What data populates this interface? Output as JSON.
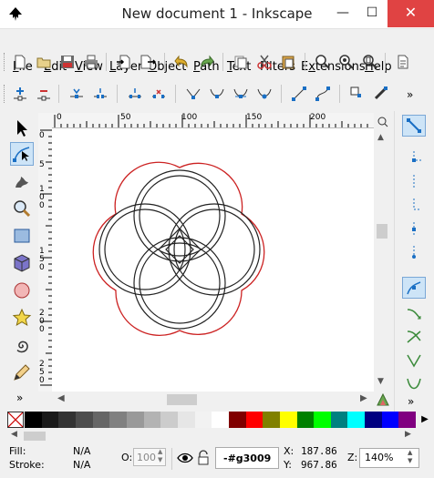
{
  "window": {
    "title": "New document 1 - Inkscape",
    "minimize": "—",
    "maximize": "☐",
    "close": "✕"
  },
  "menu": [
    {
      "label": "File",
      "u": "F",
      "rest": "ile"
    },
    {
      "label": "Edit",
      "u": "E",
      "rest": "dit"
    },
    {
      "label": "View",
      "u": "V",
      "rest": "iew"
    },
    {
      "label": "Layer",
      "u": "L",
      "rest": "ayer"
    },
    {
      "label": "Object",
      "u": "O",
      "rest": "bject"
    },
    {
      "label": "Path",
      "u": "P",
      "rest": "ath"
    },
    {
      "label": "Text",
      "u": "T",
      "rest": "ext"
    },
    {
      "label": "Filters",
      "u": "",
      "rest": "Filters"
    },
    {
      "label": "Extensions",
      "u": "x",
      "rest": "tensions"
    },
    {
      "label": "Help",
      "u": "H",
      "rest": "elp"
    }
  ],
  "rulers": {
    "top": [
      "0",
      "50",
      "100",
      "150",
      "200"
    ],
    "left": [
      "0",
      "5",
      "1 0 0",
      "1 5 0",
      "2 0 0",
      "2 5 0"
    ]
  },
  "expanders": {
    "overflow": "»"
  },
  "palette": [
    "#000000",
    "#1a1a1a",
    "#333333",
    "#4d4d4d",
    "#666666",
    "#808080",
    "#999999",
    "#b3b3b3",
    "#cccccc",
    "#e6e6e6",
    "#f2f2f2",
    "#ffffff",
    "#800000",
    "#ff0000",
    "#808000",
    "#ffff00",
    "#008000",
    "#00ff00",
    "#008080",
    "#00ffff",
    "#000080",
    "#0000ff",
    "#800080"
  ],
  "status": {
    "fill_label": "Fill:",
    "fill_value": "N/A",
    "stroke_label": "Stroke:",
    "stroke_value": "N/A",
    "opacity_label": "O:",
    "opacity_value": "100",
    "layer_value": "-#g3009",
    "x_label": "X:",
    "x_value": "187.86",
    "y_label": "Y:",
    "y_value": "967.86",
    "zoom_label": "Z:",
    "zoom_value": "140%"
  }
}
